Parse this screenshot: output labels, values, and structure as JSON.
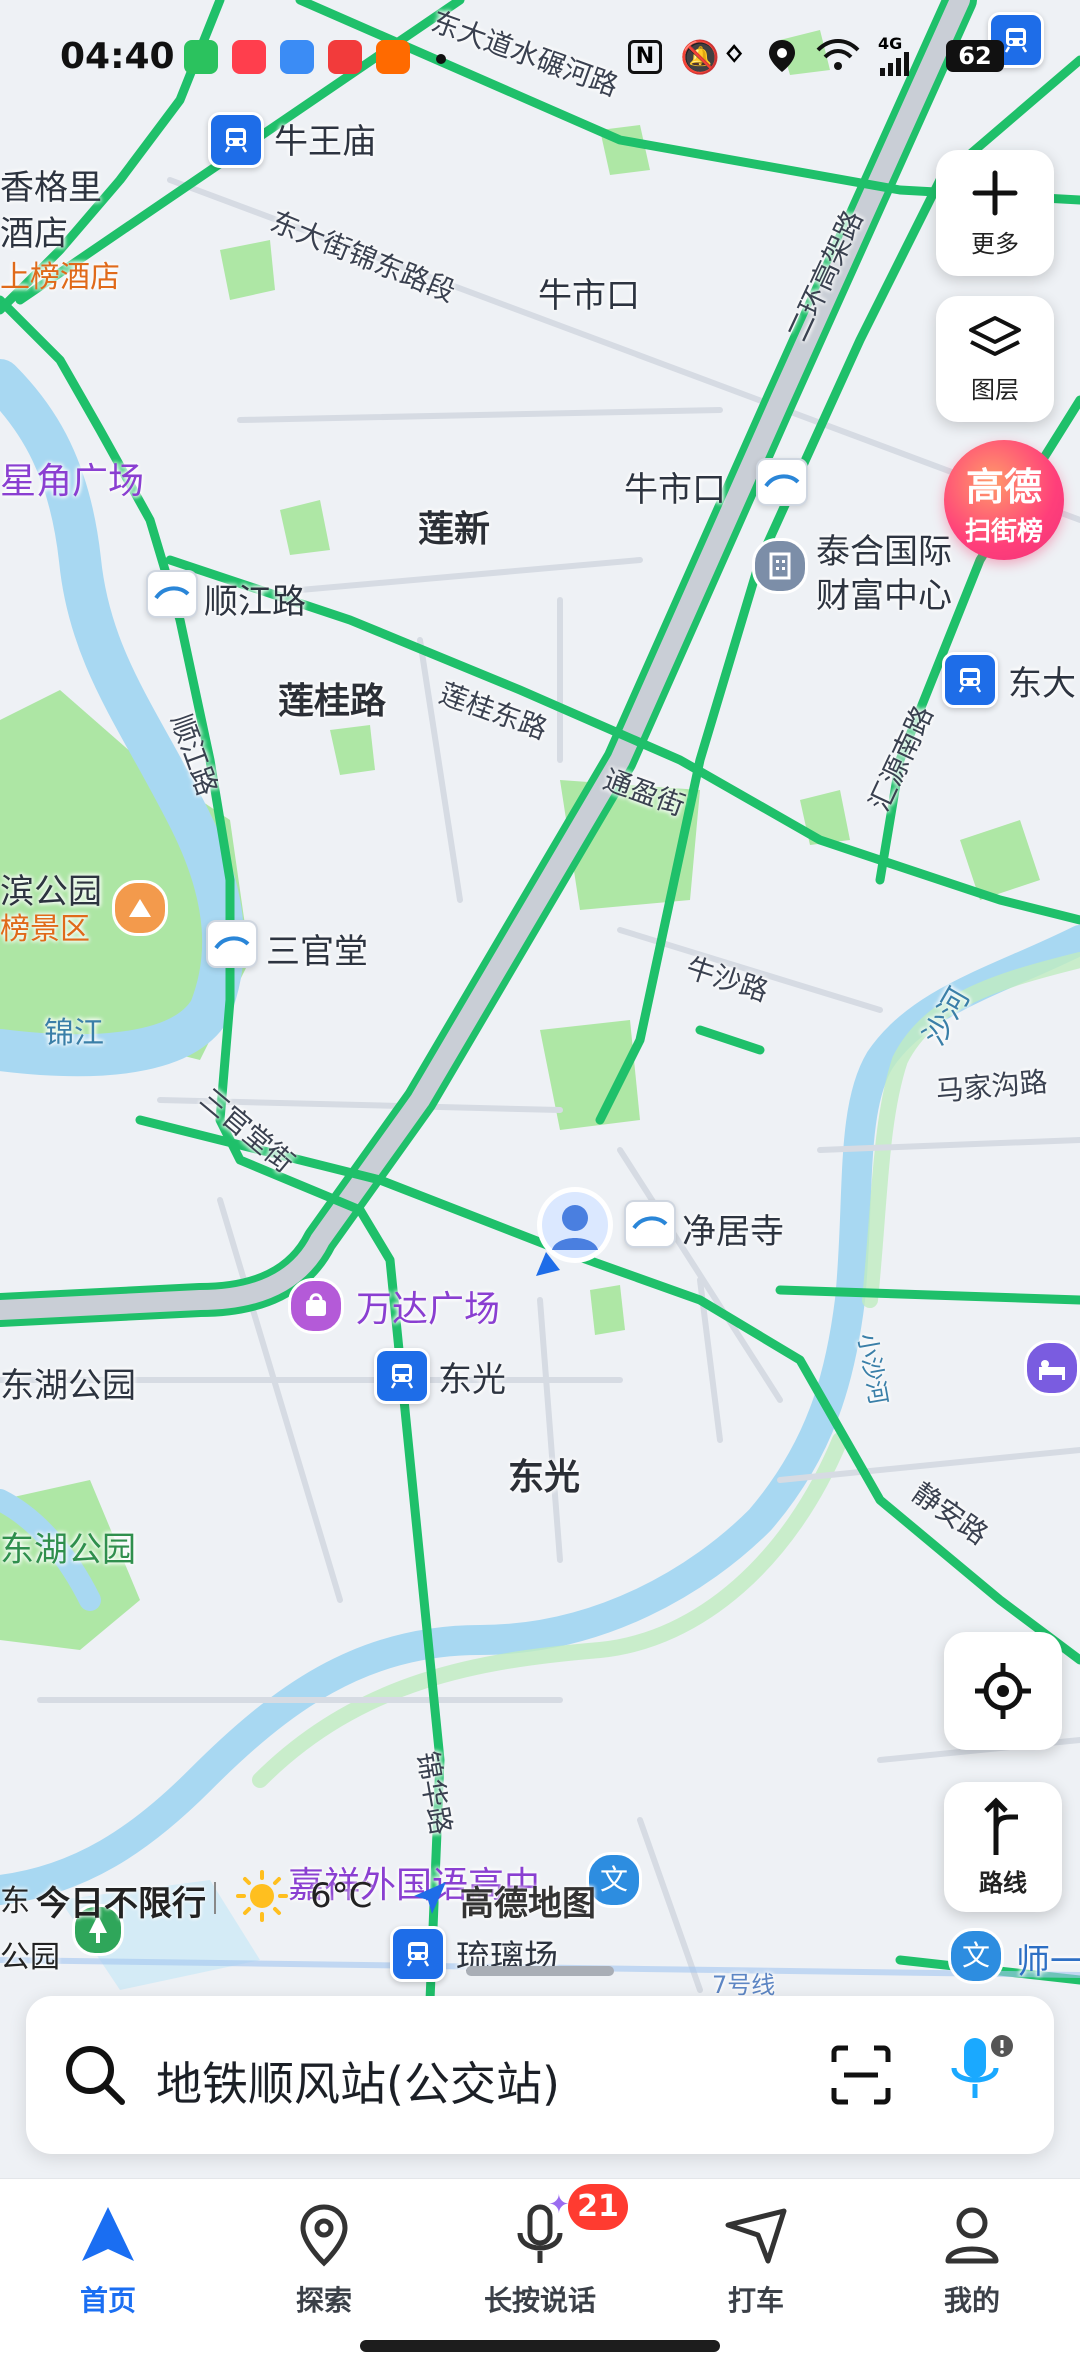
{
  "status_bar": {
    "time": "04:40",
    "signal_label": "4G",
    "battery": "62"
  },
  "map": {
    "area_labels": [
      "莲新",
      "莲桂路",
      "东光"
    ],
    "road_labels": [
      "东大街锦东路段",
      "莲桂东路",
      "通盈街",
      "牛沙路",
      "顺江路",
      "三官堂街",
      "马家沟路",
      "静安路",
      "锦华路",
      "二环高架路",
      "东大道水碾河路",
      "汇源南路",
      "沙河",
      "小沙河",
      "7号线"
    ],
    "station_labels": {
      "niuwangmiao": "牛王庙",
      "niushikou_area": "牛市口",
      "niushikou_bus": "牛市口",
      "shunjianglu": "顺江路",
      "sanguantang": "三官堂",
      "jingjusi": "净居寺",
      "dongguang": "东光",
      "liulichang": "琉璃场",
      "dongda": "东大"
    },
    "poi_labels": {
      "shangrila_1": "香格里",
      "shangrila_2": "酒店",
      "shangbang_hotel": "上榜酒店",
      "xingjiao_square": "星角广场",
      "taihe_1": "泰合国际",
      "taihe_2": "财富中心",
      "park_left": "滨公园",
      "scenic": "榜景区",
      "wanda": "万达广场",
      "donghu_1": "东湖公园",
      "donghu_2": "东湖公园",
      "jinjiang": "锦江",
      "jiaxiang_school": "嘉祥外国语高中",
      "shiyi": "师一"
    }
  },
  "controls": {
    "more_label": "更多",
    "layers_label": "图层",
    "gaode_top": "高德",
    "gaode_bottom": "扫街榜",
    "route_label": "路线"
  },
  "map_footer": {
    "traffic_notice": "今日不限行",
    "temperature": "6°C",
    "brand": "高德地图",
    "left_park_1": "东",
    "left_park_2": "公园"
  },
  "search": {
    "text": "地铁顺风站(公交站)"
  },
  "bottom_nav": {
    "items": [
      {
        "label": "首页",
        "icon": "navigation-arrow-icon"
      },
      {
        "label": "探索",
        "icon": "location-pin-icon"
      },
      {
        "label": "长按说话",
        "icon": "microphone-icon"
      },
      {
        "label": "打车",
        "icon": "taxi-arrow-icon"
      },
      {
        "label": "我的",
        "icon": "profile-icon"
      }
    ],
    "voice_badge": "21"
  },
  "colors": {
    "accent": "#1a6ef2",
    "road_green": "#1fc06a",
    "water": "#a8d8f2",
    "park": "#8fdc86",
    "metro_blue": "#1e6de8",
    "badge_red": "#ff3b30"
  }
}
